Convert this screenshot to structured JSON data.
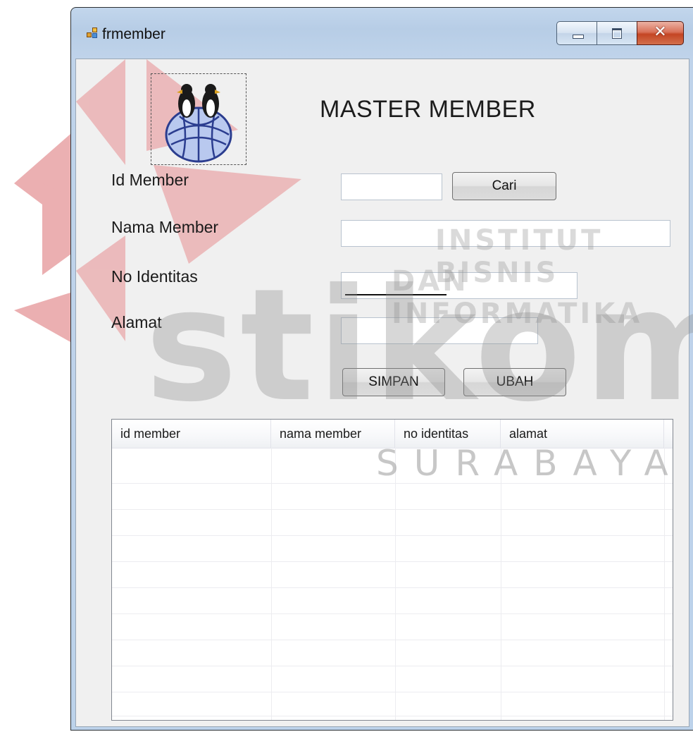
{
  "window": {
    "title": "frmember",
    "controls": {
      "minimize_icon": "minimize-icon",
      "maximize_icon": "maximize-icon",
      "close_icon": "close-icon",
      "close_glyph": "✕"
    }
  },
  "form": {
    "heading": "MASTER MEMBER",
    "logo": "penguin-globe-logo",
    "fields": {
      "id_member": {
        "label": "Id Member",
        "value": ""
      },
      "nama_member": {
        "label": "Nama Member",
        "value": ""
      },
      "no_identitas": {
        "label": "No Identitas",
        "value": ""
      },
      "alamat": {
        "label": "Alamat",
        "value": ""
      }
    },
    "buttons": {
      "cari": "Cari",
      "simpan": "SIMPAN",
      "ubah": "UBAH"
    }
  },
  "grid": {
    "columns": [
      "id member",
      "nama member",
      "no identitas",
      "alamat"
    ],
    "rows": []
  },
  "watermark": {
    "brand": "stikom",
    "line1": "INSTITUT BISNIS",
    "line2": "DAN INFORMATIKA",
    "city": "SURABAYA",
    "accent_color": "#d9262b"
  }
}
